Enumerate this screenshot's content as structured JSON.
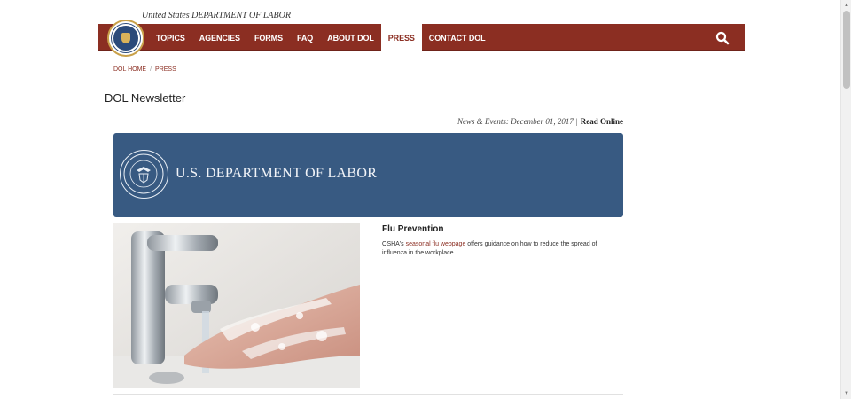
{
  "header": {
    "agency_line": "United States DEPARTMENT OF LABOR",
    "seal_icon": "dol-seal-icon",
    "search_icon": "search-icon",
    "nav": [
      {
        "label": "TOPICS",
        "active": false
      },
      {
        "label": "AGENCIES",
        "active": false
      },
      {
        "label": "FORMS",
        "active": false
      },
      {
        "label": "FAQ",
        "active": false
      },
      {
        "label": "ABOUT DOL",
        "active": false
      },
      {
        "label": "PRESS",
        "active": true
      },
      {
        "label": "CONTACT DOL",
        "active": false
      }
    ]
  },
  "breadcrumb": {
    "home": "DOL HOME",
    "separator": "/",
    "current": "PRESS"
  },
  "page": {
    "title": "DOL Newsletter",
    "news_date": "News & Events: December 01, 2017",
    "separator": "|",
    "read_online": "Read Online"
  },
  "banner": {
    "title": "U.S. DEPARTMENT OF LABOR"
  },
  "article": {
    "title": "Flu Prevention",
    "text_before": "OSHA's ",
    "link_text": "seasonal flu webpage",
    "text_after": " offers guidance on how to reduce the spread of influenza in the workplace."
  },
  "colors": {
    "nav_bg": "#8b2e22",
    "banner_bg": "#385a82",
    "link": "#8b2e22"
  }
}
